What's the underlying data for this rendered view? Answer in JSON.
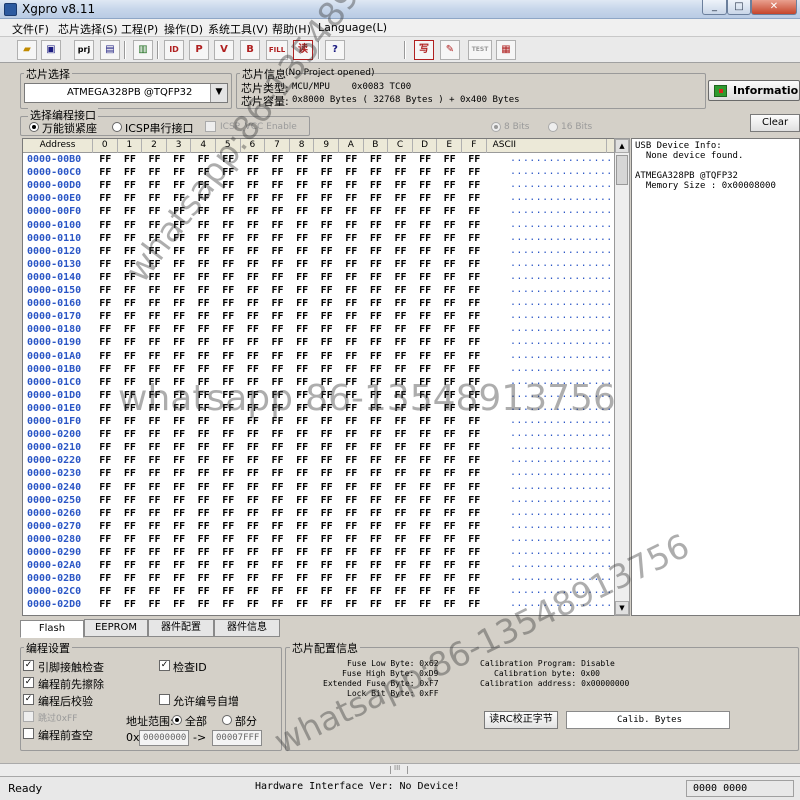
{
  "window": {
    "title": "Xgpro v8.11",
    "minimize": "_",
    "maximize": "□",
    "close": "✕"
  },
  "menu": [
    "文件(F)",
    "芯片选择(S)",
    "工程(P)",
    "操作(D)",
    "系统工具(V)",
    "帮助(H)",
    "Language(L)"
  ],
  "toolbar": {
    "icons": [
      "open-icon",
      "save-icon",
      "project-icon",
      "save-project-icon",
      "save-all-icon",
      "read-id-icon",
      "program-icon",
      "verify-icon",
      "blank-check-icon",
      "fill-icon",
      "read-icon",
      "help-icon",
      "write-icon",
      "erase-icon",
      "test-icon",
      "select-icon"
    ],
    "labels": {
      "project": "prj",
      "fill": "FILL",
      "read": "读",
      "help": "?",
      "write": "写",
      "test": "TEST"
    }
  },
  "chip_select": {
    "label": "芯片选择",
    "selected": "ATMEGA328PB @TQFP32"
  },
  "chip_info": {
    "label": "芯片信息",
    "project_status": "(No Project opened)",
    "type_label": "芯片类型:",
    "type_value": "MCU/MPU    0x0083 TC00",
    "capacity_label": "芯片容量:",
    "capacity_value": "0x8000 Bytes ( 32768 Bytes ) + 0x400 Bytes",
    "information_button": "Information"
  },
  "interface": {
    "label": "选择编程接口",
    "options": [
      "万能锁紧座",
      "ICSP串行接口"
    ],
    "selected": "万能锁紧座",
    "icsp_vcc": "ICSP_VCC Enable",
    "bits_8": "8 Bits",
    "bits_16": "16 Bits",
    "clear_button": "Clear"
  },
  "hex": {
    "headers": [
      "Address",
      "0",
      "1",
      "2",
      "3",
      "4",
      "5",
      "6",
      "7",
      "8",
      "9",
      "A",
      "B",
      "C",
      "D",
      "E",
      "F",
      "ASCII"
    ],
    "addresses": [
      "0000-00B0",
      "0000-00C0",
      "0000-00D0",
      "0000-00E0",
      "0000-00F0",
      "0000-0100",
      "0000-0110",
      "0000-0120",
      "0000-0130",
      "0000-0140",
      "0000-0150",
      "0000-0160",
      "0000-0170",
      "0000-0180",
      "0000-0190",
      "0000-01A0",
      "0000-01B0",
      "0000-01C0",
      "0000-01D0",
      "0000-01E0",
      "0000-01F0",
      "0000-0200",
      "0000-0210",
      "0000-0220",
      "0000-0230",
      "0000-0240",
      "0000-0250",
      "0000-0260",
      "0000-0270",
      "0000-0280",
      "0000-0290",
      "0000-02A0",
      "0000-02B0",
      "0000-02C0",
      "0000-02D0"
    ],
    "byte_value": "FF",
    "ascii_value": "................"
  },
  "log": "USB Device Info:\n  None device found.\n\nATMEGA328PB @TQFP32\n  Memory Size : 0x00008000",
  "tabs": [
    "Flash",
    "EEPROM",
    "器件配置",
    "器件信息"
  ],
  "tab_active": "Flash",
  "settings": {
    "label": "编程设置",
    "check_pins": "引脚接触检查",
    "erase_before": "编程前先擦除",
    "verify_after": "编程后校验",
    "skip_ff": "跳过0xFF",
    "blank_before": "编程前查空",
    "check_id": "检查ID",
    "auto_serial": "允许编号自增",
    "range_label": "地址范围:",
    "range_all": "全部",
    "range_part": "部分",
    "from_label": "0x",
    "range_start": "00000000",
    "arrow": "->",
    "range_end": "00007FFF"
  },
  "config": {
    "label": "芯片配置信息",
    "lines": [
      "Fuse Low Byte: 0x62",
      "Fuse High Byte: 0xD9",
      "Extended Fuse Byte: 0xF7",
      "Lock Bit Byte: 0xFF"
    ],
    "calib": [
      "Calibration Program: Disable",
      "Calibration byte: 0x00",
      "Calibration address: 0x00000000"
    ],
    "read_rc_button": "读RC校正字节",
    "calib_bytes_button": "Calib. Bytes"
  },
  "status": {
    "ready": "Ready",
    "hardware": "Hardware Interface Ver: No Device!",
    "counter": "0000 0000",
    "scroll_mark": "III"
  },
  "watermark": "whatsapp:86-13548913756",
  "colors": {
    "address": "#2a56c6",
    "ascii": "#2a56c6",
    "accent_green": "#2e9a2e"
  }
}
